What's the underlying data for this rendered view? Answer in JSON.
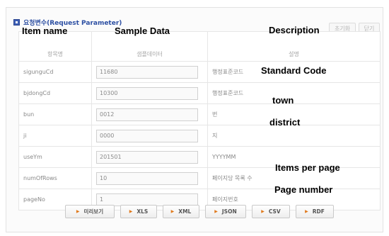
{
  "section_title": "요청변수(Request Parameter)",
  "top_buttons": {
    "reset": "초기화",
    "close": "닫기"
  },
  "columns": {
    "name_ko": "항목명",
    "sample_ko": "샘플데이터",
    "desc_ko": "설명"
  },
  "rows": [
    {
      "name": "sigunguCd",
      "value": "11680",
      "desc": "행정표준코드"
    },
    {
      "name": "bjdongCd",
      "value": "10300",
      "desc": "행정표준코드"
    },
    {
      "name": "bun",
      "value": "0012",
      "desc": "번"
    },
    {
      "name": "ji",
      "value": "0000",
      "desc": "지"
    },
    {
      "name": "useYm",
      "value": "201501",
      "desc": "YYYYMM"
    },
    {
      "name": "numOfRows",
      "value": "10",
      "desc": "페이지당 목록 수"
    },
    {
      "name": "pageNo",
      "value": "1",
      "desc": "페이지번호"
    }
  ],
  "annotations": {
    "item_name": "Item name",
    "sample_data": "Sample Data",
    "description": "Description",
    "standard_code": "Standard Code",
    "town": "town",
    "district": "district",
    "items_per_page": "Items per page",
    "page_number": "Page number"
  },
  "bottom_buttons": [
    "미리보기",
    "XLS",
    "XML",
    "JSON",
    "CSV",
    "RDF"
  ],
  "colors": {
    "title": "#2c4fa3",
    "arrow": "#e07a1d"
  }
}
